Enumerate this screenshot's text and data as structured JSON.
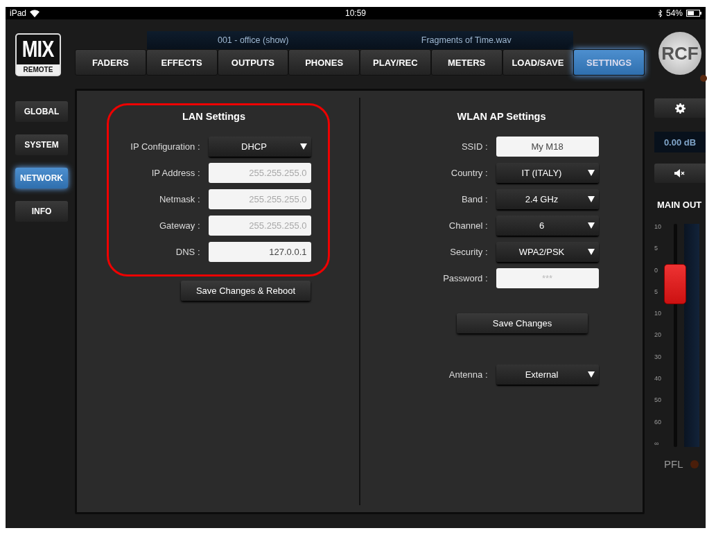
{
  "status_bar": {
    "device": "iPad",
    "time": "10:59",
    "battery": "54%"
  },
  "logo": {
    "top": "MIX",
    "bottom": "REMOTE"
  },
  "now_playing": {
    "scene": "001 - office (show)",
    "file": "Fragments of Time.wav"
  },
  "tabs": [
    {
      "label": "FADERS",
      "selected": false
    },
    {
      "label": "EFFECTS",
      "selected": false
    },
    {
      "label": "OUTPUTS",
      "selected": false
    },
    {
      "label": "PHONES",
      "selected": false
    },
    {
      "label": "PLAY/REC",
      "selected": false
    },
    {
      "label": "METERS",
      "selected": false
    },
    {
      "label": "LOAD/SAVE",
      "selected": false
    },
    {
      "label": "SETTINGS",
      "selected": true
    }
  ],
  "brand": "RCF",
  "sidebar": {
    "items": [
      {
        "label": "GLOBAL",
        "selected": false
      },
      {
        "label": "SYSTEM",
        "selected": false
      },
      {
        "label": "NETWORK",
        "selected": true
      },
      {
        "label": "INFO",
        "selected": false
      }
    ]
  },
  "lan": {
    "title": "LAN Settings",
    "highlighted": true,
    "rows": [
      {
        "kind": "select",
        "label": "IP Configuration :",
        "value": "DHCP"
      },
      {
        "kind": "text",
        "label": "IP Address :",
        "value": "255.255.255.0",
        "disabled": true
      },
      {
        "kind": "text",
        "label": "Netmask :",
        "value": "255.255.255.0",
        "disabled": true
      },
      {
        "kind": "text",
        "label": "Gateway :",
        "value": "255.255.255.0",
        "disabled": true
      },
      {
        "kind": "text",
        "label": "DNS :",
        "value": "127.0.0.1",
        "disabled": false
      }
    ],
    "button": "Save Changes & Reboot"
  },
  "wlan": {
    "title": "WLAN AP Settings",
    "rows": [
      {
        "kind": "text",
        "label": "SSID :",
        "value": "My M18",
        "disabled": false
      },
      {
        "kind": "select",
        "label": "Country :",
        "value": "IT (ITALY)"
      },
      {
        "kind": "select",
        "label": "Band :",
        "value": "2.4 GHz"
      },
      {
        "kind": "select",
        "label": "Channel :",
        "value": "6"
      },
      {
        "kind": "select",
        "label": "Security :",
        "value": "WPA2/PSK"
      },
      {
        "kind": "password",
        "label": "Password :",
        "placeholder": "***"
      }
    ],
    "button": "Save Changes",
    "antenna": {
      "label": "Antenna :",
      "value": "External"
    }
  },
  "main_out": {
    "gain": "0.00 dB",
    "title": "MAIN OUT",
    "level": 0.73,
    "scale": [
      "10",
      "5",
      "0",
      "5",
      "10",
      "20",
      "30",
      "40",
      "50",
      "60",
      "∞"
    ],
    "pfl": {
      "label": "PFL",
      "on": false
    }
  }
}
